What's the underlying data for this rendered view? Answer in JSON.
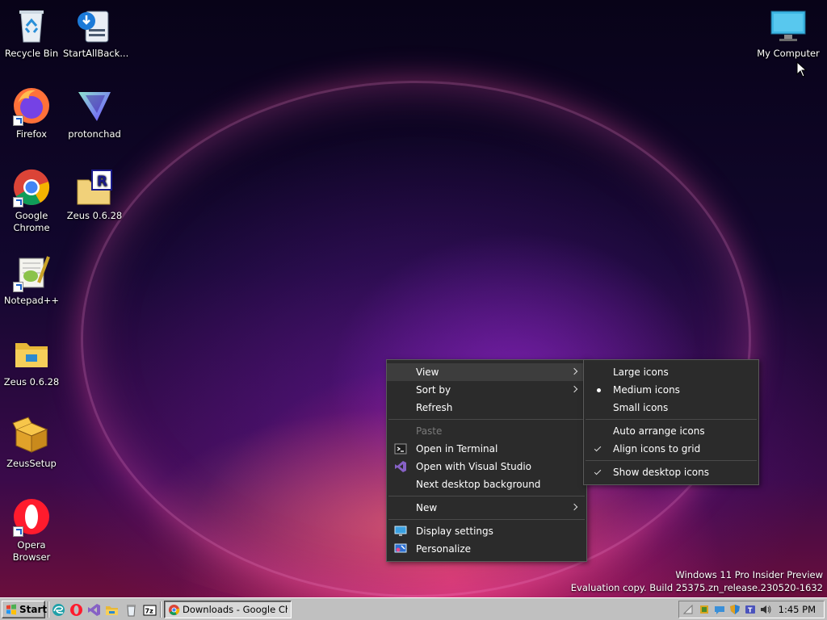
{
  "desktop": {
    "icons": [
      {
        "label": "Recycle Bin",
        "icon": "recycle-bin-icon"
      },
      {
        "label": "StartAllBack...",
        "icon": "startallback-icon"
      },
      {
        "label": "Firefox",
        "icon": "firefox-icon"
      },
      {
        "label": "protonchad",
        "icon": "protonvpn-icon"
      },
      {
        "label": "Google Chrome",
        "icon": "chrome-icon"
      },
      {
        "label": "Zeus 0.6.28",
        "icon": "zeus-archive-icon"
      },
      {
        "label": "Notepad++",
        "icon": "notepadpp-icon"
      },
      {
        "label": "Zeus 0.6.28",
        "icon": "folder-icon"
      },
      {
        "label": "ZeusSetup",
        "icon": "setup-box-icon"
      },
      {
        "label": "Opera Browser",
        "icon": "opera-icon"
      },
      {
        "label": "My Computer",
        "icon": "monitor-icon"
      }
    ],
    "watermark": {
      "line1": "Windows 11 Pro Insider Preview",
      "line2": "Evaluation copy. Build 25375.zn_release.230520-1632"
    }
  },
  "context_menu": {
    "items": [
      {
        "label": "View",
        "submenu": true
      },
      {
        "label": "Sort by",
        "submenu": true
      },
      {
        "label": "Refresh"
      },
      {
        "label": "Paste",
        "disabled": true
      },
      {
        "label": "Open in Terminal",
        "icon": "terminal-icon"
      },
      {
        "label": "Open with Visual Studio",
        "icon": "visual-studio-icon"
      },
      {
        "label": "Next desktop background"
      },
      {
        "label": "New",
        "submenu": true
      },
      {
        "label": "Display settings",
        "icon": "display-icon"
      },
      {
        "label": "Personalize",
        "icon": "personalize-icon"
      }
    ]
  },
  "view_submenu": {
    "items": [
      {
        "label": "Large icons"
      },
      {
        "label": "Medium icons",
        "selected": true
      },
      {
        "label": "Small icons"
      },
      {
        "label": "Auto arrange icons"
      },
      {
        "label": "Align icons to grid",
        "checked": true
      },
      {
        "label": "Show desktop icons",
        "checked": true
      }
    ]
  },
  "taskbar": {
    "start_label": "Start",
    "quicklaunch": [
      "edge-icon",
      "opera-icon",
      "visual-studio-icon",
      "explorer-icon",
      "recycle-icon",
      "7zip-icon"
    ],
    "task_label": "Downloads - Google Chro...",
    "tray_icons": [
      "network-icon",
      "security-icon",
      "chat-icon",
      "shield-icon",
      "teams-icon",
      "volume-icon"
    ],
    "clock": "1:45 PM"
  },
  "colors": {
    "menu_bg": "#2b2b2b",
    "menu_hover": "#3d3d3d",
    "taskbar_bg": "#c0c0c0",
    "disabled_text": "#7a7a7a"
  }
}
